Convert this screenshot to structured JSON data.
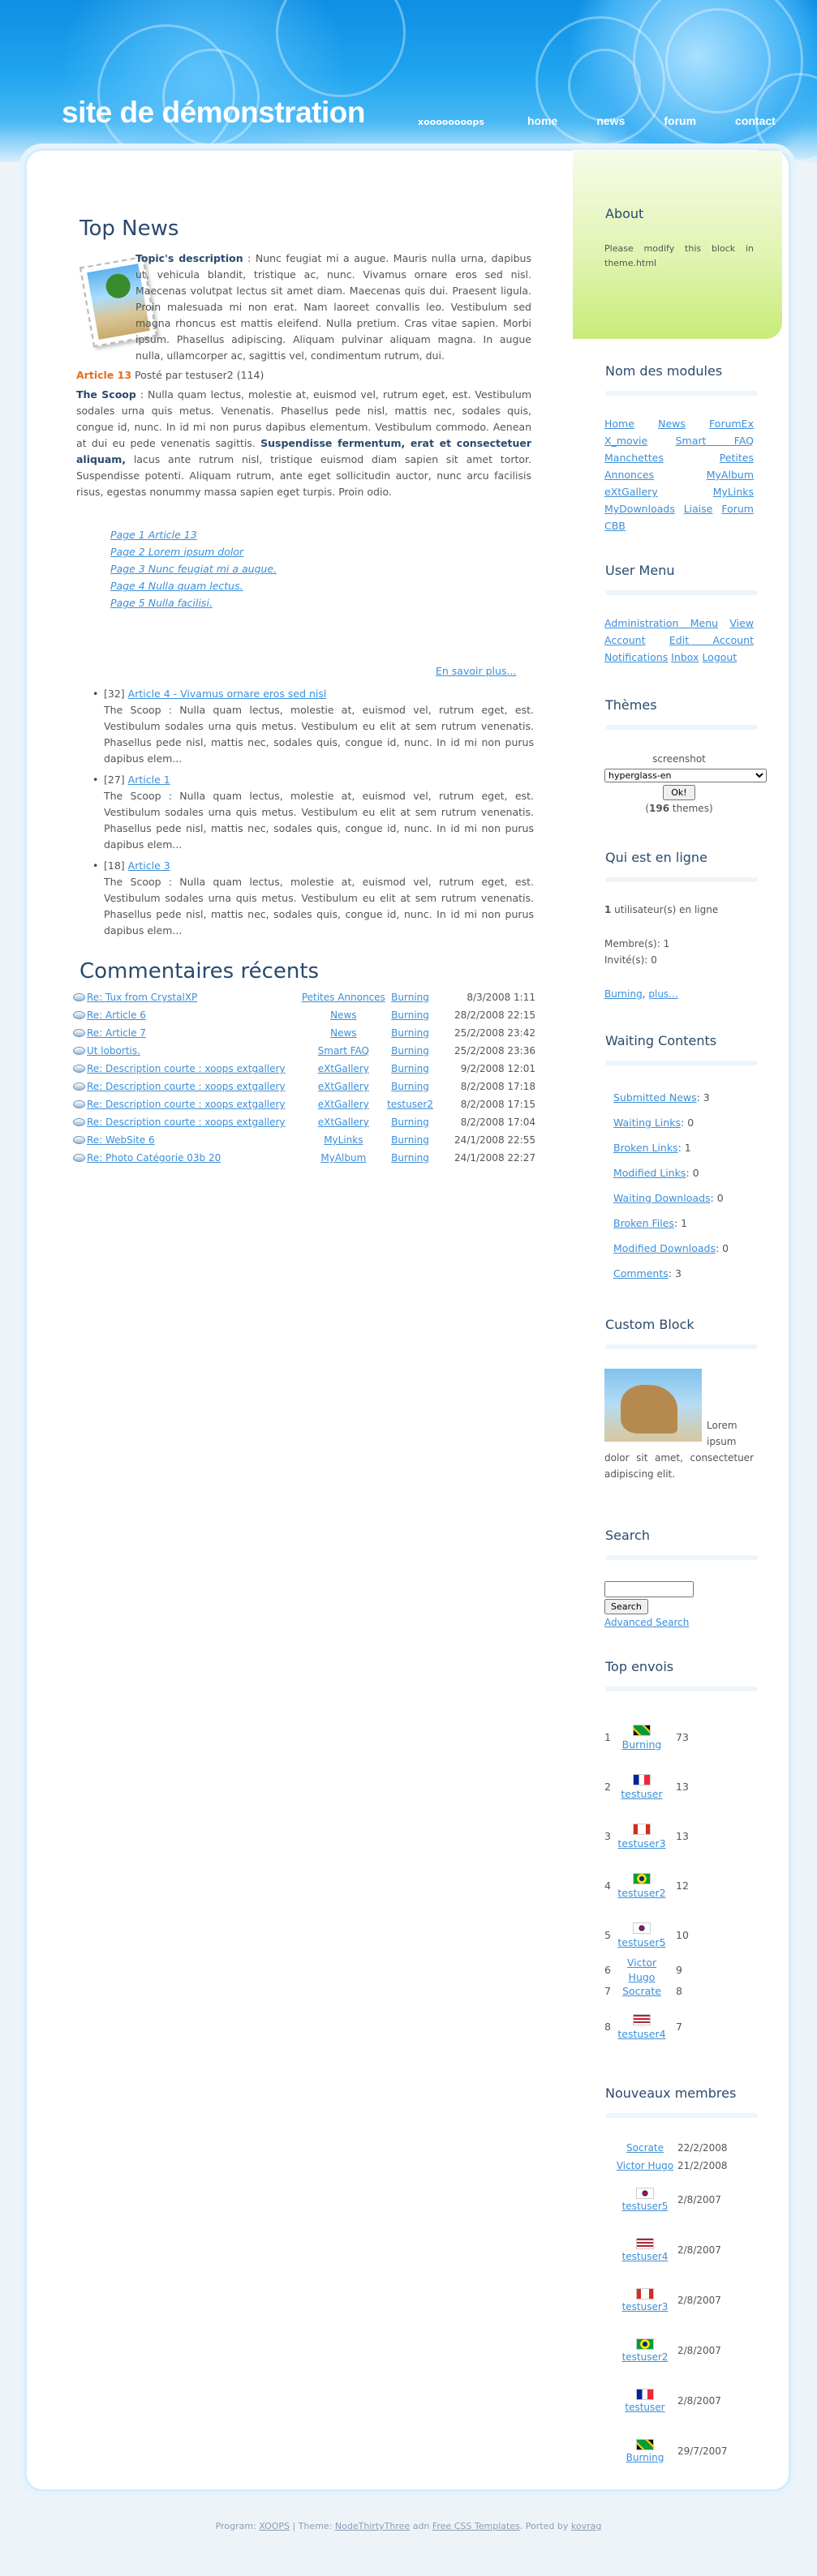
{
  "header": {
    "title": "site de démonstration",
    "slogan": "xoooooooops",
    "nav": [
      "home",
      "news",
      "forum",
      "contact"
    ]
  },
  "top_news": {
    "title": "Top News",
    "intro_label": "Topic's description",
    "intro_text": " : Nunc feugiat mi a augue. Mauris nulla urna, dapibus ut, vehicula blandit, tristique ac, nunc. Vivamus ornare eros sed nisl. Maecenas volutpat lectus sit amet diam. Maecenas quis dui. Praesent ligula. Proin malesuada mi non erat. Nam laoreet convallis leo. Vestibulum sed magna rhoncus est mattis eleifend. Nulla pretium. Cras vitae sapien. Morbi ipsum. Phasellus adipiscing. Aliquam pulvinar aliquam magna. In augue nulla, ullamcorper ac, sagittis vel, condimentum rutrum, dui.",
    "article_label": "Article 13",
    "article_meta": " Posté par testuser2 (114)",
    "scoop_label": "The Scoop",
    "scoop_text_1": " : Nulla quam lectus, molestie at, euismod vel, rutrum eget, est. Vestibulum sodales urna quis metus. Venenatis. Phasellus pede nisl, mattis nec, sodales quis, congue id, nunc. In id mi non purus dapibus elementum. Vestibulum commodo. Aenean at dui eu pede venenatis sagittis. ",
    "scoop_bold": "Suspendisse fermentum, erat et consectetuer aliquam,",
    "scoop_text_2": " lacus ante rutrum nisl, tristique euismod diam sapien sit amet tortor. Suspendisse potenti. Aliquam rutrum, ante eget sollicitudin auctor, nunc arcu facilisis risus, egestas nonummy massa sapien eget turpis. Proin odio.",
    "pages": [
      "Page 1 Article 13",
      "Page 2 Lorem ipsum dolor",
      "Page 3 Nunc feugiat mi a augue.",
      "Page 4 Nulla quam lectus.",
      "Page 5 Nulla facilisi."
    ],
    "more": "En savoir plus...",
    "others": [
      {
        "count": "[32]",
        "title": "Article 4 - Vivamus ornare eros sed nisl",
        "text": "The Scoop : Nulla quam lectus, molestie at, euismod vel, rutrum eget, est. Vestibulum sodales urna quis metus. Vestibulum eu elit at sem rutrum venenatis. Phasellus pede nisl, mattis nec, sodales quis, congue id, nunc. In id mi non purus dapibus elem..."
      },
      {
        "count": "[27]",
        "title": "Article 1",
        "text": "The Scoop : Nulla quam lectus, molestie at, euismod vel, rutrum eget, est. Vestibulum sodales urna quis metus. Vestibulum eu elit at sem rutrum venenatis. Phasellus pede nisl, mattis nec, sodales quis, congue id, nunc. In id mi non purus dapibus elem..."
      },
      {
        "count": "[18]",
        "title": "Article 3",
        "text": "The Scoop : Nulla quam lectus, molestie at, euismod vel, rutrum eget, est. Vestibulum sodales urna quis metus. Vestibulum eu elit at sem rutrum venenatis. Phasellus pede nisl, mattis nec, sodales quis, congue id, nunc. In id mi non purus dapibus elem..."
      }
    ]
  },
  "comments": {
    "title": "Commentaires récents",
    "rows": [
      [
        "Re: Tux from CrystalXP",
        "Petites Annonces",
        "Burning",
        "8/3/2008 1:11"
      ],
      [
        "Re: Article 6",
        "News",
        "Burning",
        "28/2/2008 22:15"
      ],
      [
        "Re: Article 7",
        "News",
        "Burning",
        "25/2/2008 23:42"
      ],
      [
        "Ut lobortis.",
        "Smart FAQ",
        "Burning",
        "25/2/2008 23:36"
      ],
      [
        "Re: Description courte : xoops extgallery",
        "eXtGallery",
        "Burning",
        "9/2/2008 12:01"
      ],
      [
        "Re: Description courte : xoops extgallery",
        "eXtGallery",
        "Burning",
        "8/2/2008 17:18"
      ],
      [
        "Re: Description courte : xoops extgallery",
        "eXtGallery",
        "testuser2",
        "8/2/2008 17:15"
      ],
      [
        "Re: Description courte : xoops extgallery",
        "eXtGallery",
        "Burning",
        "8/2/2008 17:04"
      ],
      [
        "Re: WebSite 6",
        "MyLinks",
        "Burning",
        "24/1/2008 22:55"
      ],
      [
        "Re: Photo Catégorie 03b 20",
        "MyAlbum",
        "Burning",
        "24/1/2008 22:27"
      ]
    ]
  },
  "sidebar": {
    "about_title": "About",
    "about_text": "Please modify this block in theme.html",
    "modules_title": "Nom des modules",
    "modules": [
      "Home",
      "News",
      "ForumEx",
      "X_movie",
      "Smart FAQ",
      "Manchettes",
      "Petites Annonces",
      "MyAlbum",
      "eXtGallery",
      "MyLinks",
      "MyDownloads",
      "Liaise",
      "Forum",
      "CBB"
    ],
    "usermenu_title": "User Menu",
    "usermenu": [
      "Administration Menu",
      "View Account",
      "Edit Account",
      "Notifications",
      "Inbox",
      "Logout"
    ],
    "themes_title": "Thèmes",
    "themes_label": "screenshot",
    "themes_selected": "hyperglass-en",
    "themes_ok": "Ok!",
    "themes_count": "196",
    "themes_count_suffix": " themes)",
    "online_title": "Qui est en ligne",
    "online_users_count": "1",
    "online_users_text": " utilisateur(s) en ligne",
    "online_members": "Membre(s): 1",
    "online_guests": "Invité(s): 0",
    "online_link1": "Burning",
    "online_link2": "plus...",
    "waiting_title": "Waiting Contents",
    "waiting": [
      [
        "Submitted News",
        ": 3"
      ],
      [
        "Waiting Links",
        ": 0"
      ],
      [
        "Broken Links",
        ": 1"
      ],
      [
        "Modified Links",
        ": 0"
      ],
      [
        "Waiting Downloads",
        ": 0"
      ],
      [
        "Broken Files",
        ": 1"
      ],
      [
        "Modified Downloads",
        ": 0"
      ],
      [
        "Comments",
        ": 3"
      ]
    ],
    "custom_title": "Custom Block",
    "custom_text": "Lorem ipsum dolor sit amet, consectetuer adipiscing elit.",
    "search_title": "Search",
    "search_button": "Search",
    "search_advanced": "Advanced Search",
    "top_title": "Top envois",
    "top": [
      [
        "1",
        "Burning",
        "73",
        "jm"
      ],
      [
        "2",
        "testuser",
        "13",
        "fr"
      ],
      [
        "3",
        "testuser3",
        "13",
        "ca"
      ],
      [
        "4",
        "testuser2",
        "12",
        "br"
      ],
      [
        "5",
        "testuser5",
        "10",
        "kr"
      ],
      [
        "6",
        "Victor Hugo",
        "9",
        ""
      ],
      [
        "7",
        "Socrate",
        "8",
        ""
      ],
      [
        "8",
        "testuser4",
        "7",
        "us"
      ]
    ],
    "new_title": "Nouveaux membres",
    "new_members": [
      [
        "Socrate",
        "22/2/2008",
        ""
      ],
      [
        "Victor Hugo",
        "21/2/2008",
        ""
      ],
      [
        "testuser5",
        "2/8/2007",
        "kr"
      ],
      [
        "testuser4",
        "2/8/2007",
        "us"
      ],
      [
        "testuser3",
        "2/8/2007",
        "ca"
      ],
      [
        "testuser2",
        "2/8/2007",
        "br"
      ],
      [
        "testuser",
        "2/8/2007",
        "fr"
      ],
      [
        "Burning",
        "29/7/2007",
        "jm"
      ]
    ]
  },
  "footer": {
    "program": "Program: ",
    "xoops": "XOOPS",
    "theme": " | Theme: ",
    "theme_name": "NodeThirtyThree",
    "adn": " adn ",
    "templates": "Free CSS Templates",
    "ported": ". Ported by ",
    "author": "kovrag"
  }
}
